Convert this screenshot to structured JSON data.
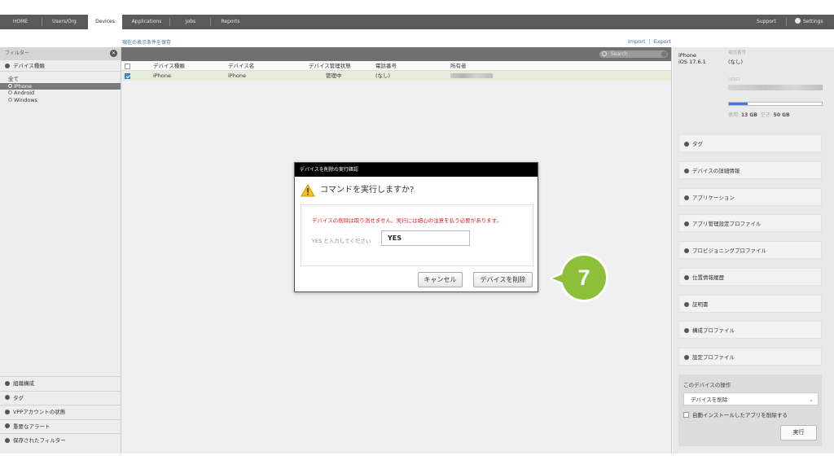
{
  "nav": {
    "tabs": [
      {
        "label": "HOME"
      },
      {
        "label": "Users/Org"
      },
      {
        "label": "Devices"
      },
      {
        "label": "Applications"
      },
      {
        "label": "Jobs"
      },
      {
        "label": "Reports"
      }
    ],
    "active_tab": "Devices",
    "support": "Support",
    "settings": "Settings"
  },
  "save_filter": "現在の表示条件を保存",
  "import": "Import",
  "export": "Export",
  "sidebar": {
    "filter_header": "フィルター",
    "device_type_header": "デバイス種類",
    "items": [
      {
        "label": "全て",
        "selected": false
      },
      {
        "label": "iPhone",
        "selected": true
      },
      {
        "label": "Android",
        "selected": false
      },
      {
        "label": "Windows",
        "selected": false
      }
    ],
    "bottom_sections": [
      "組織構成",
      "タグ",
      "VPPアカウントの状態",
      "重要なアラート",
      "保存されたフィルター"
    ]
  },
  "search": {
    "placeholder": "Search"
  },
  "table": {
    "headers": [
      "デバイス種類",
      "デバイス名",
      "デバイス管理状態",
      "電話番号",
      "所有者"
    ],
    "rows": [
      {
        "type": "iPhone",
        "name": "iPhone",
        "status": "管理中",
        "phone": "(なし)",
        "checked": true
      }
    ]
  },
  "detail": {
    "device_name": "iPhone",
    "os": "iOS 17.6.1",
    "phone_label": "電話番号",
    "phone_value": "(なし)",
    "udid_label": "UDID",
    "storage_used_fraction": 0.2,
    "storage_used_label": "使用:",
    "storage_used_value": "13 GB",
    "storage_free_label": "空き:",
    "storage_free_value": "50 GB",
    "sections": [
      "タグ",
      "デバイスの詳細情報",
      "アプリケーション",
      "アプリ管理設定プロファイル",
      "プロビジョニングプロファイル",
      "位置情報履歴",
      "証明書",
      "構成プロファイル",
      "設定プロファイル"
    ],
    "operations_title": "このデバイスの操作",
    "operation_selected": "デバイスを削除",
    "auto_install_checkbox": "自動インストールしたアプリを削除する",
    "run_button": "実行"
  },
  "modal": {
    "title": "デバイスを削除の実行確認",
    "question": "コマンドを実行しますか?",
    "warning": "デバイスの削除は取り消せません。実行には細心の注意を払う必要があります。",
    "input_label": "YES と入力してください",
    "input_value": "YES",
    "cancel": "キャンセル",
    "confirm": "デバイスを削除"
  },
  "step_badge": "7",
  "colors": {
    "badge_green": "#8dbf3a",
    "accent_blue": "#3a8fd8",
    "warning_red": "#e02020"
  }
}
